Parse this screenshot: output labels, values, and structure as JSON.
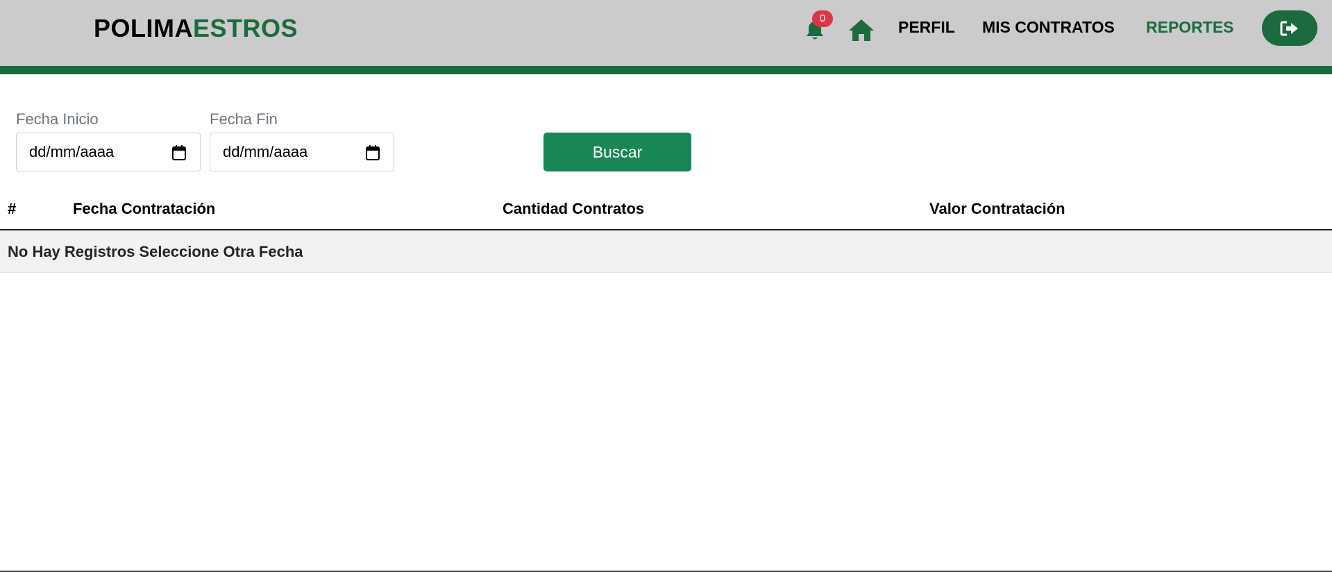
{
  "brand": {
    "part1": "POLIMA",
    "part2": "ESTROS"
  },
  "colors": {
    "accent": "#1b6b3f",
    "button": "#198754",
    "badge": "#dc3545",
    "navbar_bg": "#cbcbcb"
  },
  "nav": {
    "notifications": {
      "icon": "bell-icon",
      "count": "0"
    },
    "home_icon": "home-icon",
    "links": [
      {
        "label": "PERFIL"
      },
      {
        "label": "MIS CONTRATOS"
      },
      {
        "label": "REPORTES",
        "active": true
      }
    ],
    "logout_icon": "sign-out-icon"
  },
  "filters": {
    "start": {
      "label": "Fecha Inicio",
      "placeholder": "dd/mm/aaaa"
    },
    "end": {
      "label": "Fecha Fin",
      "placeholder": "dd/mm/aaaa"
    },
    "search_label": "Buscar"
  },
  "table": {
    "columns": [
      "#",
      "Fecha Contratación",
      "Cantidad Contratos",
      "Valor Contratación"
    ],
    "empty_message": "No Hay Registros Seleccione Otra Fecha"
  }
}
